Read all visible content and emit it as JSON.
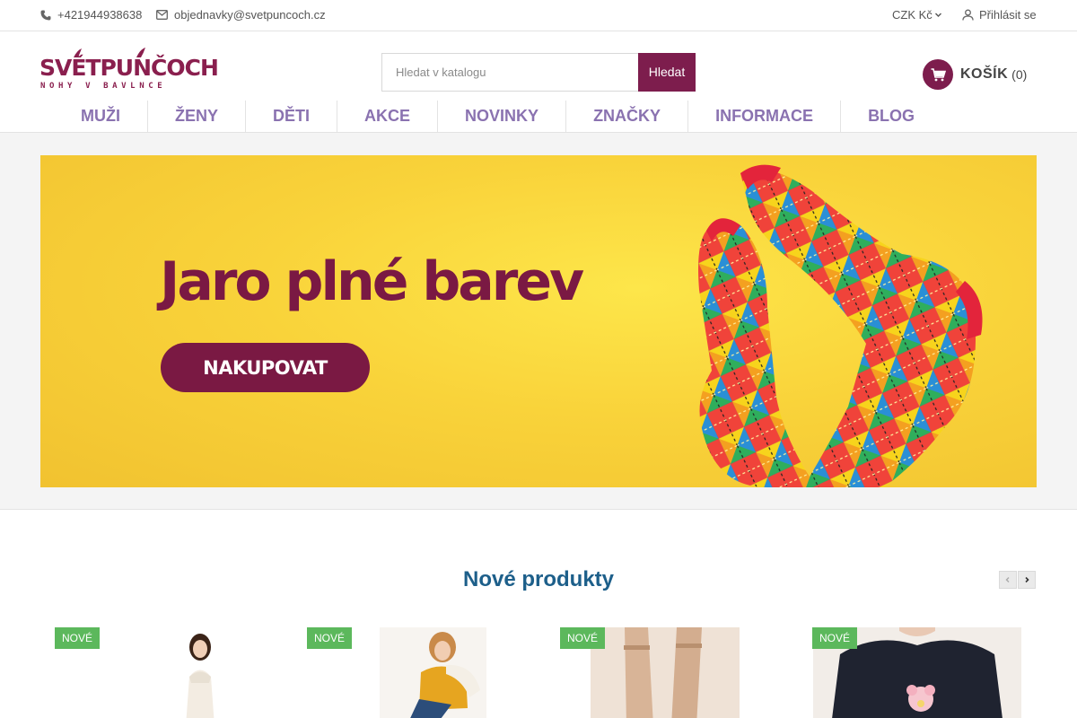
{
  "topbar": {
    "phone": "+421944938638",
    "email": "objednavky@svetpuncoch.cz",
    "currency": "CZK Kč",
    "login": "Přihlásit se"
  },
  "logo": {
    "name": "SVĚTPUNČOCH",
    "tagline": "NOHY V BAVLNCE"
  },
  "search": {
    "placeholder": "Hledat v katalogu",
    "button": "Hledat"
  },
  "cart": {
    "label": "KOŠÍK",
    "count": "(0)"
  },
  "nav": {
    "items": [
      "MUŽI",
      "ŽENY",
      "DĚTI",
      "AKCE",
      "NOVINKY",
      "ZNAČKY",
      "INFORMACE",
      "BLOG"
    ]
  },
  "banner": {
    "headline": "Jaro plné barev",
    "cta": "NAKUPOVAT"
  },
  "new_products": {
    "title": "Nové produkty",
    "badge": "NOVÉ",
    "items": [
      {
        "badge": "NOVÉ",
        "image": "girl-white-dress"
      },
      {
        "badge": "NOVÉ",
        "image": "girl-jeans-yellow-top"
      },
      {
        "badge": "NOVÉ",
        "image": "nude-ankle-socks"
      },
      {
        "badge": "NOVÉ",
        "image": "black-tshirt-cartoon"
      }
    ]
  },
  "colors": {
    "brand": "#7d1d4d",
    "nav_text": "#8a72b0",
    "section_title": "#1d5f8a",
    "badge": "#5cb85c",
    "banner_bg": "#f9d33a"
  }
}
